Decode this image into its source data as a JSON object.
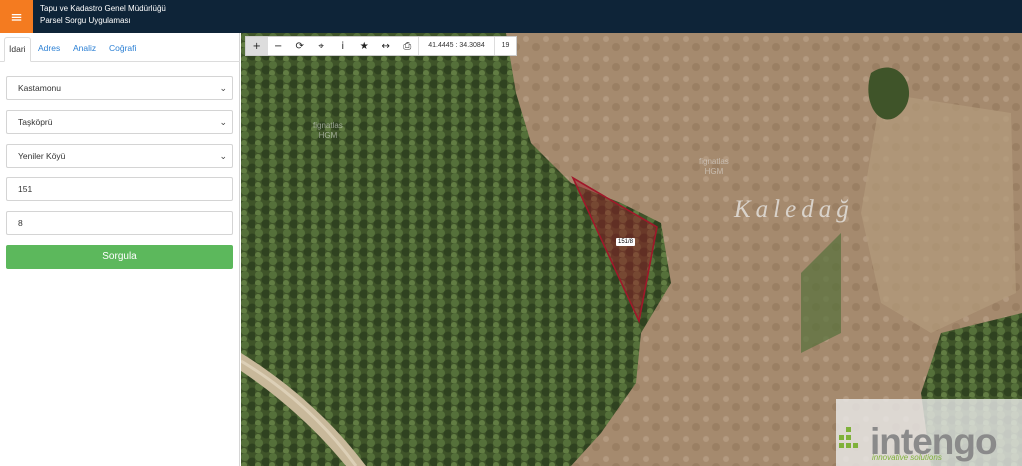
{
  "header": {
    "menu_icon": "≡",
    "title_line1": "Tapu ve Kadastro Genel Müdürlüğü",
    "title_line2": "Parsel Sorgu Uygulaması",
    "bg_color": "#0e2438",
    "accent_color": "#f47b20"
  },
  "sidebar": {
    "tabs": [
      {
        "label": "İdari",
        "active": true
      },
      {
        "label": "Adres"
      },
      {
        "label": "Analiz"
      },
      {
        "label": "Coğrafi"
      }
    ],
    "province": "Kastamonu",
    "district": "Taşköprü",
    "neighborhood": "Yeniler Köyü",
    "block_no": "151",
    "parcel_no": "8",
    "query_button": "Sorgula",
    "query_button_color": "#5cb85c"
  },
  "toolbar": {
    "zoom_in": "+",
    "zoom_out": "−",
    "refresh": "⟳",
    "locate": "⌖",
    "info": "i",
    "favorite": "★",
    "measure": "↔",
    "print": "⎙",
    "coordinates": "41.4445 : 34.3084",
    "zoom_level": "19"
  },
  "map": {
    "watermark1": "fignatlas\nHGM",
    "watermark2": "fignatlas\nHGM",
    "place_name": "Kaledağ",
    "parcel_label": "151/8",
    "parcel_color": "#a0182a",
    "logo_text": "intengo",
    "logo_sub": "innovative solutions",
    "logo_icon": "grid-logo-icon"
  }
}
